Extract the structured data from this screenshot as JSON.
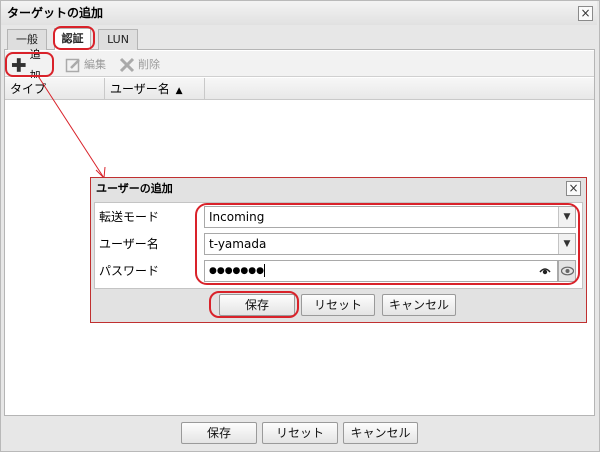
{
  "dialog": {
    "title": "ターゲットの追加",
    "close_glyph": "×",
    "tabs": [
      {
        "label": "一般",
        "active": false
      },
      {
        "label": "認証",
        "active": true
      },
      {
        "label": "LUN",
        "active": false
      }
    ],
    "toolbar": {
      "add_label": "追加",
      "edit_label": "編集",
      "delete_label": "削除"
    },
    "grid": {
      "columns": [
        "タイプ",
        "ユーザー名"
      ],
      "sort_indicator": "▲"
    },
    "footer": {
      "save": "保存",
      "reset": "リセット",
      "cancel": "キャンセル"
    }
  },
  "add_user_dialog": {
    "title": "ユーザーの追加",
    "close_glyph": "×",
    "fields": {
      "transfer_mode_label": "転送モード",
      "transfer_mode_value": "Incoming",
      "username_label": "ユーザー名",
      "username_value": "t-yamada",
      "password_label": "パスワード",
      "password_value": "●●●●●●●"
    },
    "buttons": {
      "save": "保存",
      "reset": "リセット",
      "cancel": "キャンセル"
    }
  },
  "colors": {
    "highlight": "#d9222a",
    "dialog_bg": "#e7e7e7"
  }
}
